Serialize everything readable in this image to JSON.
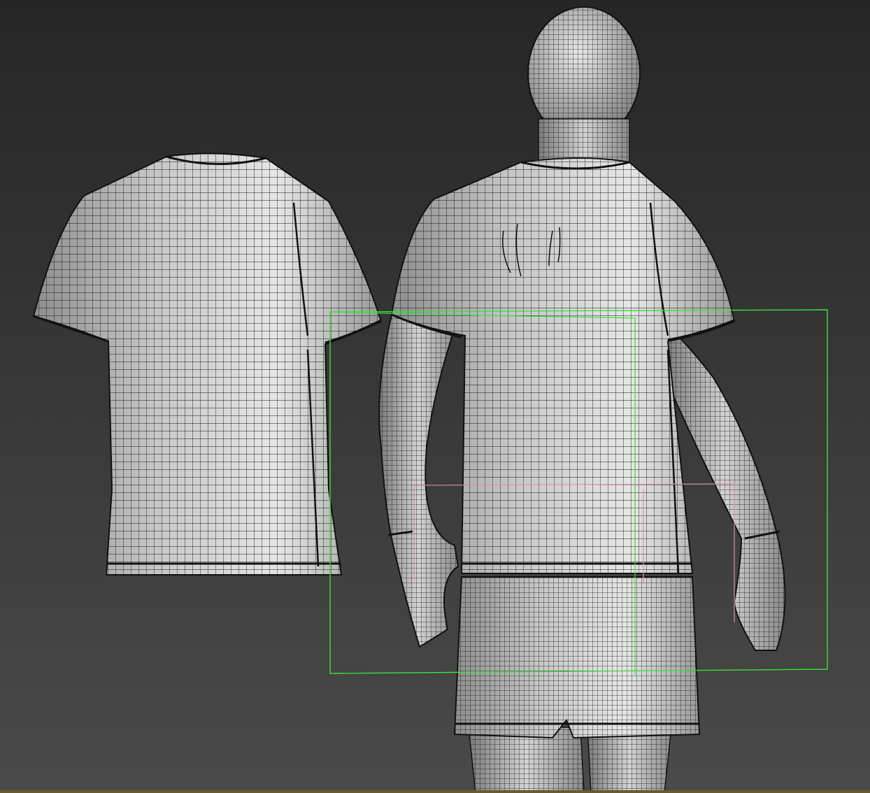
{
  "viewport": {
    "view": "perspective",
    "render_mode": "wireframe-on-shaded",
    "background_colors": [
      "#262626",
      "#4a4a4a"
    ],
    "mesh_color": "#d8d8d8",
    "wire_color": "#111111"
  },
  "scene": {
    "objects": [
      {
        "kind": "t-shirt",
        "selected": false
      },
      {
        "kind": "character-with-t-shirt-and-shorts",
        "selected": true
      }
    ],
    "selection_box_color": "#39e03a",
    "secondary_bbox_color": "#e38ab0",
    "status_bar_color": "#6b5a2e"
  }
}
